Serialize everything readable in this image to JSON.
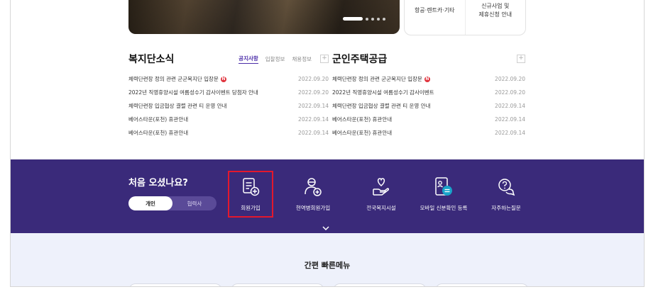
{
  "banner": {
    "slide_count": 5,
    "active_slide": 1
  },
  "quick_card": {
    "cells": [
      "항공·렌트카·기타",
      "신규사업 및\n제휴신청 안내"
    ]
  },
  "welfare_news": {
    "title": "복지단소식",
    "tabs": [
      "공지사항",
      "입찰정보",
      "채용정보"
    ],
    "active_tab": "공지사항",
    "more_label": "+",
    "items": [
      {
        "text": "체력단련장 정의 관련 군군복지단 입장문",
        "date": "2022.09.20",
        "new": "N"
      },
      {
        "text": "2022년 직영휴양시설 여름성수기 감사이벤트 당첨자 안내",
        "date": "2022.09.20",
        "new": ""
      },
      {
        "text": "체력단련장 입금협상 결렬 관련 티 운영 안내",
        "date": "2022.09.14",
        "new": ""
      },
      {
        "text": "베어스타운(포천) 휴관안내",
        "date": "2022.09.14",
        "new": ""
      },
      {
        "text": "베어스타운(포천) 휴관안내",
        "date": "2022.09.14",
        "new": ""
      }
    ]
  },
  "housing": {
    "title": "군인주택공급",
    "more_label": "+",
    "items": [
      {
        "text": "체력단련장 정의 관련 군군복지단 입장문",
        "date": "2022.09.20",
        "new": "N"
      },
      {
        "text": "2022년 직영휴양시설 여름성수기 감사이벤트",
        "date": "2022.09.20",
        "new": ""
      },
      {
        "text": "체력단련장 입금협상 결렬 관련 티 운영 안내",
        "date": "2022.09.14",
        "new": ""
      },
      {
        "text": "베어스타운(포천) 휴관안내",
        "date": "2022.09.14",
        "new": ""
      },
      {
        "text": "베어스타운(포천) 휴관안내",
        "date": "2022.09.14",
        "new": ""
      }
    ]
  },
  "first_visit": {
    "title": "처음 오셨나요?",
    "toggle": [
      "개인",
      "협력사"
    ],
    "active_toggle": "개인",
    "services": [
      {
        "label": "회원가입",
        "icon": "document-plus-icon"
      },
      {
        "label": "현역병회원가입",
        "icon": "user-plus-icon"
      },
      {
        "label": "전국복지시설",
        "icon": "heart-hand-icon"
      },
      {
        "label": "모바일 신분확인 등록",
        "icon": "mobile-id-icon"
      },
      {
        "label": "자주하는질문",
        "icon": "question-chat-icon"
      }
    ],
    "highlighted_service": "회원가입",
    "highlight_color": "#e3182d",
    "band_color": "#3a2a7a"
  },
  "quick_menu": {
    "title": "간편 빠른메뉴"
  },
  "colors": {
    "accent": "#4a2ca8",
    "new_badge": "#e0323c",
    "light_bg": "#eef1fb"
  }
}
